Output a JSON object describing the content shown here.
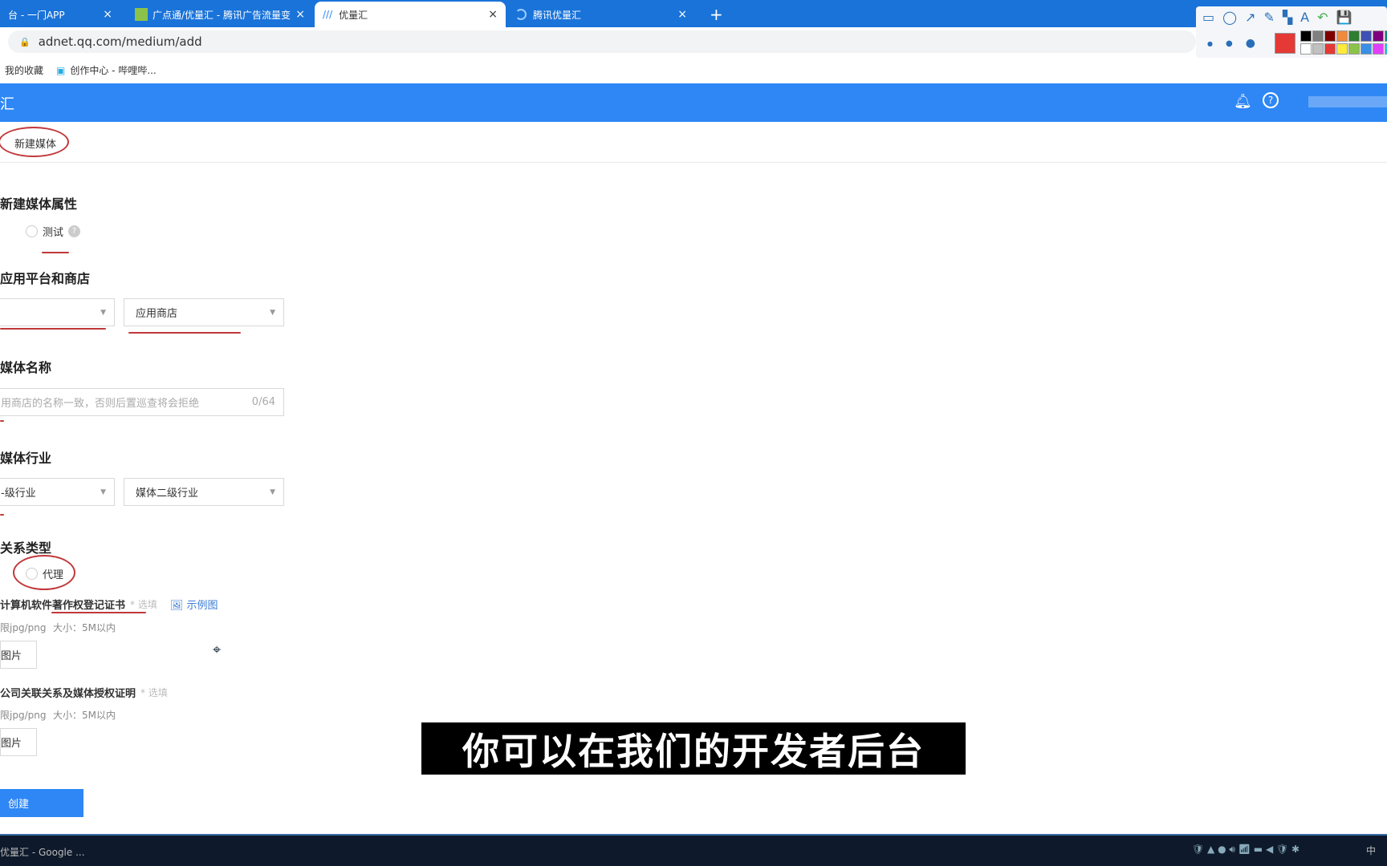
{
  "browser": {
    "tabs": [
      {
        "label": "台 - 一门APP"
      },
      {
        "label": "广点通/优量汇 - 腾讯广告流量变"
      },
      {
        "label": "优量汇"
      },
      {
        "label": "腾讯优量汇"
      }
    ],
    "close": "×",
    "new_tab": "+",
    "url": "adnet.qq.com/medium/add",
    "bookmarks": [
      "我的收藏",
      "创作中心 - 哔哩哔..."
    ]
  },
  "header": {
    "logo": "汇"
  },
  "breadcrumb": "新建媒体",
  "form": {
    "attr": {
      "title": "新建媒体属性",
      "option": "测试",
      "help": "?"
    },
    "platform": {
      "title": "应用平台和商店",
      "select1": "",
      "select2": "应用商店"
    },
    "name": {
      "title": "媒体名称",
      "placeholder": "用商店的名称一致，否则后置巡查将会拒绝",
      "count": "0/64"
    },
    "industry": {
      "title": "媒体行业",
      "select1": "-级行业",
      "select2": "媒体二级行业"
    },
    "relation": {
      "title": "关系类型",
      "option": "代理"
    },
    "cert1": {
      "title": "计算机软件著作权登记证书",
      "optional": "* 选填",
      "example": "示例图",
      "format": "限jpg/png",
      "size": "大小：5M以内",
      "upload": "图片"
    },
    "cert2": {
      "title": "公司关联关系及媒体授权证明",
      "optional": "* 选填",
      "format": "限jpg/png",
      "size": "大小：5M以内",
      "upload": "图片"
    },
    "submit": "创建"
  },
  "subtitle": "你可以在我们的开发者后台",
  "taskbar": {
    "item": "优量汇 - Google ...",
    "ime": "中"
  },
  "colors": {
    "primary": "#2e87f5",
    "annotation": "#c0393b",
    "tabbar": "#1a73d9"
  },
  "annotation_palette": [
    "#000000",
    "#808080",
    "#800000",
    "#f08a3c",
    "#2e7d32",
    "#3f51b5",
    "#800080",
    "#00897b",
    "#ffffff",
    "#c0c0c0",
    "#e53935",
    "#ffeb3b",
    "#8bc34a",
    "#3a8ee6",
    "#e040fb",
    "#26c6da"
  ]
}
